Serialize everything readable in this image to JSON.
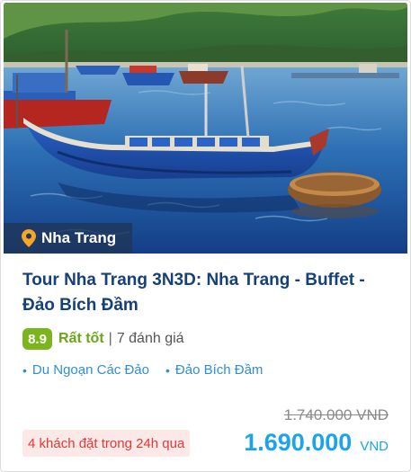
{
  "tour_card": {
    "location": "Nha Trang",
    "title": "Tour Nha Trang 3N3D: Nha Trang - Buffet - Đảo Bích Đầm",
    "rating": {
      "score": "8.9",
      "label": "Rất tốt",
      "separator": "|",
      "reviews": "7 đánh giá"
    },
    "tags": [
      "Du Ngoạn Các Đảo",
      "Đảo Bích Đầm"
    ],
    "original_price": "1.740.000 VND",
    "booked_notice": "4 khách đặt trong 24h qua",
    "price": {
      "amount": "1.690.000",
      "currency": "VND"
    }
  },
  "colors": {
    "title": "#15407a",
    "score_badge": "#7ab51d",
    "rating_label": "#6aa618",
    "tag_text": "#2f8fd6",
    "price": "#1ba4ec",
    "booked_text": "#e03a3a",
    "booked_bg": "#fde8e8",
    "location_tag_bg": "#1e375a"
  },
  "icons": {
    "location": "map-pin-icon",
    "tag_bullet": "bullet-dot"
  }
}
